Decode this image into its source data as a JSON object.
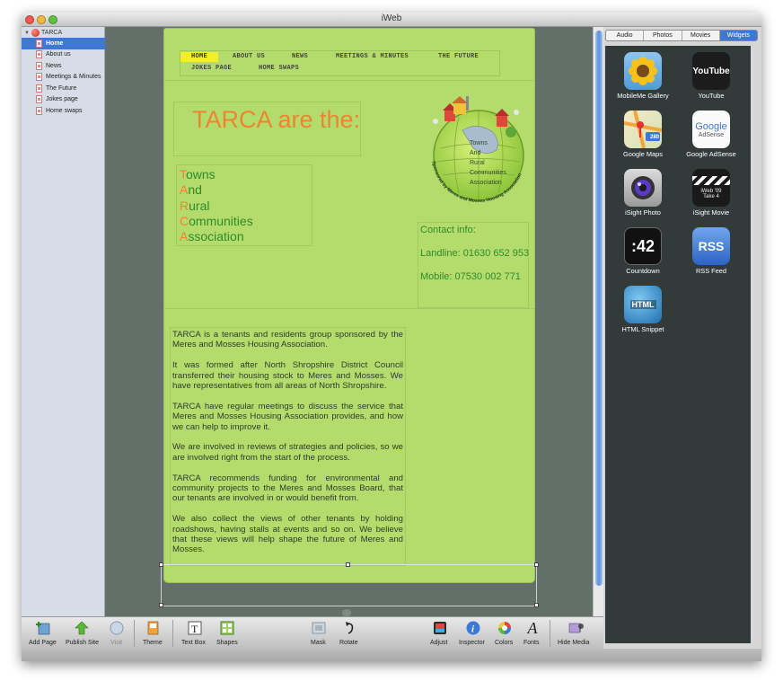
{
  "window": {
    "title": "iWeb"
  },
  "sidebar": {
    "site_name": "TARCA",
    "pages": [
      {
        "label": "Home",
        "selected": true
      },
      {
        "label": "About us"
      },
      {
        "label": "News"
      },
      {
        "label": "Meetings & Minutes"
      },
      {
        "label": "The Future"
      },
      {
        "label": "Jokes page"
      },
      {
        "label": "Home swaps"
      }
    ]
  },
  "webpage": {
    "nav": {
      "items": [
        "HOME",
        "ABOUT US",
        "NEWS",
        "MEETINGS & MINUTES",
        "THE FUTURE",
        "JOKES PAGE",
        "HOME SWAPS"
      ],
      "active": "HOME"
    },
    "headline": "TARCA are the:",
    "acronym": [
      {
        "first": "T",
        "rest": "owns"
      },
      {
        "first": "A",
        "rest": "nd"
      },
      {
        "first": "R",
        "rest": "ural"
      },
      {
        "first": "C",
        "rest": "ommunities"
      },
      {
        "first": "A",
        "rest": "ssociation"
      }
    ],
    "logo": {
      "lines": [
        "Towns",
        "And",
        "Rural",
        "Communities",
        "Association"
      ],
      "ring_text": "Sponsored by Meres and Mosses Housing Association"
    },
    "contact": {
      "heading": "Contact info:",
      "landline": "Landline: 01630 652 953",
      "mobile": "Mobile: 07530 002 771"
    },
    "body_paragraphs": [
      "TARCA is a tenants and residents group sponsored by the Meres and Mosses Housing Association.",
      "It was formed after North Shropshire District Council transferred their housing stock to Meres and Mosses.  We have representatives from all areas of North Shropshire.",
      "TARCA have regular meetings to discuss the service that Meres and Mosses Housing Association provides, and how we can help to improve it.",
      "We are involved in reviews of strategies and policies, so we are involved right from the start of the process.",
      "TARCA recommends funding for environmental and community projects to the Meres and Mosses Board, that our tenants are involved in or would benefit from.",
      "We also collect the views of other tenants by holding roadshows, having stalls at events and so on.  We believe that these views will help shape the future of Meres and Mosses."
    ]
  },
  "media_panel": {
    "tabs": [
      "Audio",
      "Photos",
      "Movies",
      "Widgets"
    ],
    "active_tab": "Widgets",
    "widgets": [
      {
        "label": "MobileMe Gallery",
        "icon": "sunflower-icon"
      },
      {
        "label": "YouTube",
        "icon": "youtube-icon",
        "icon_text": "YouTube"
      },
      {
        "label": "Google Maps",
        "icon": "google-maps-icon",
        "icon_text": "280"
      },
      {
        "label": "Google AdSense",
        "icon": "google-adsense-icon",
        "icon_text": "Google",
        "icon_sub": "AdSense"
      },
      {
        "label": "iSight Photo",
        "icon": "camera-lens-icon"
      },
      {
        "label": "iSight Movie",
        "icon": "clapperboard-icon",
        "icon_text": "iWeb '09",
        "icon_sub": "Take 4"
      },
      {
        "label": "Countdown",
        "icon": "countdown-icon",
        "icon_text": ":42"
      },
      {
        "label": "RSS Feed",
        "icon": "rss-icon",
        "icon_text": "RSS"
      },
      {
        "label": "HTML Snippet",
        "icon": "html-globe-icon",
        "icon_text": "HTML"
      }
    ]
  },
  "toolbar": {
    "add_page": "Add Page",
    "publish_site": "Publish Site",
    "visit": "Visit",
    "theme": "Theme",
    "text_box": "Text Box",
    "shapes": "Shapes",
    "mask": "Mask",
    "rotate": "Rotate",
    "adjust": "Adjust",
    "inspector": "Inspector",
    "colors": "Colors",
    "fonts": "Fonts",
    "hide_media": "Hide Media"
  },
  "colors": {
    "page_bg": "#b4dc6c",
    "headline": "#ee8430",
    "acronym_text": "#2f8a2a",
    "nav_active": "#f4ee2a",
    "selection": "#3d78d4",
    "canvas_bg": "#637069"
  }
}
